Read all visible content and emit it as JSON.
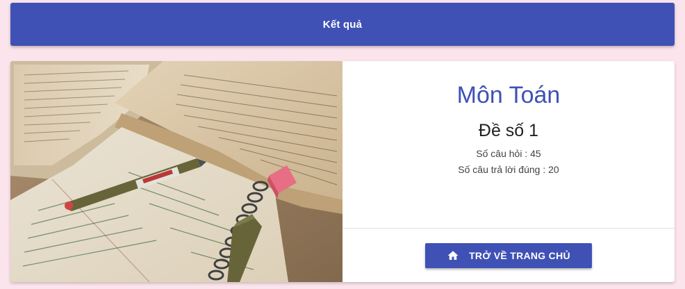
{
  "header": {
    "title": "Kết quả"
  },
  "result": {
    "subject": "Môn Toán",
    "exam": "Đề số 1",
    "question_count_text": "Số câu hỏi : 45",
    "correct_count_text": "Số câu trả lời đúng : 20",
    "question_count": 45,
    "correct_count": 20
  },
  "actions": {
    "home_label": "TRỞ VỀ TRANG CHỦ",
    "home_icon": "home-icon"
  },
  "colors": {
    "primary": "#3f51b5",
    "page_background": "#fce4ec",
    "card_background": "#ffffff"
  }
}
